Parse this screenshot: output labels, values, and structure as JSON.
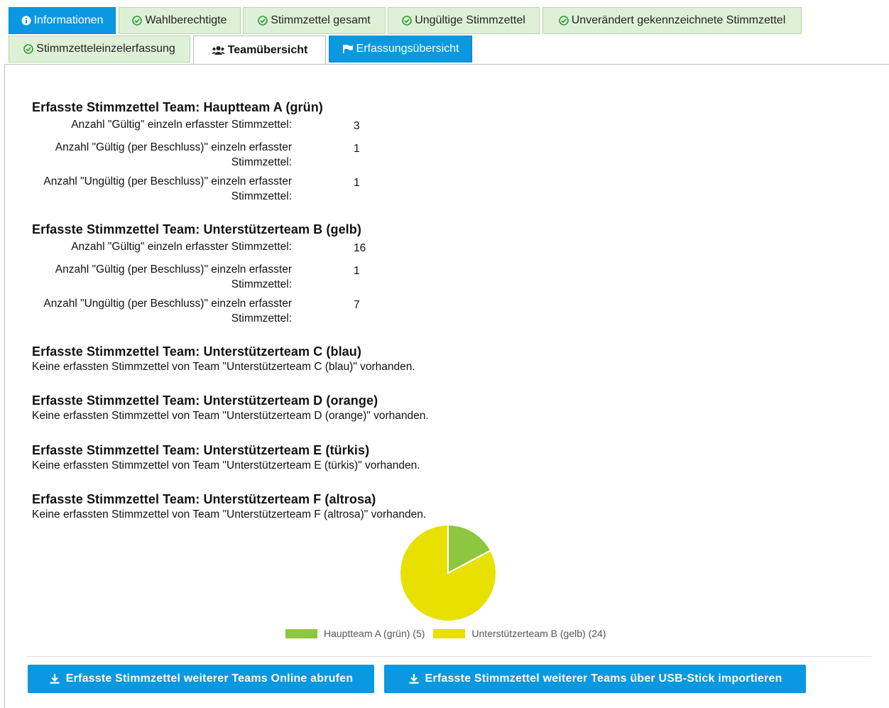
{
  "tabs": {
    "informationen": "Informationen",
    "wahlberechtigte": "Wahlberechtigte",
    "stimmzettel_gesamt": "Stimmzettel gesamt",
    "ungueltige": "Ungültige Stimmzettel",
    "unveraendert": "Unverändert gekennzeichnete Stimmzettel",
    "einzelerfassung": "Stimmzetteleinzelerfassung",
    "teamuebersicht": "Teamübersicht",
    "erfassungsuebersicht": "Erfassungsübersicht"
  },
  "teams": [
    {
      "title": "Erfasste Stimmzettel Team: Hauptteam A (grün)",
      "stats": [
        {
          "label": "Anzahl \"Gültig\" einzeln erfasster Stimmzettel:",
          "value": "3"
        },
        {
          "label": "Anzahl \"Gültig (per Beschluss)\" einzeln erfasster Stimmzettel:",
          "value": "1"
        },
        {
          "label": "Anzahl \"Ungültig (per Beschluss)\" einzeln erfasster Stimmzettel:",
          "value": "1"
        }
      ]
    },
    {
      "title": "Erfasste Stimmzettel Team: Unterstützerteam B (gelb)",
      "stats": [
        {
          "label": "Anzahl \"Gültig\" einzeln erfasster Stimmzettel:",
          "value": "16"
        },
        {
          "label": "Anzahl \"Gültig (per Beschluss)\" einzeln erfasster Stimmzettel:",
          "value": "1"
        },
        {
          "label": "Anzahl \"Ungültig (per Beschluss)\" einzeln erfasster Stimmzettel:",
          "value": "7"
        }
      ]
    },
    {
      "title": "Erfasste Stimmzettel Team: Unterstützerteam C (blau)",
      "empty": "Keine erfassten Stimmzettel von Team \"Unterstützerteam C (blau)\" vorhanden."
    },
    {
      "title": "Erfasste Stimmzettel Team: Unterstützerteam D (orange)",
      "empty": "Keine erfassten Stimmzettel von Team \"Unterstützerteam D (orange)\" vorhanden."
    },
    {
      "title": "Erfasste Stimmzettel Team: Unterstützerteam E (türkis)",
      "empty": "Keine erfassten Stimmzettel von Team \"Unterstützerteam E (türkis)\" vorhanden."
    },
    {
      "title": "Erfasste Stimmzettel Team: Unterstützerteam F (altrosa)",
      "empty": "Keine erfassten Stimmzettel von Team \"Unterstützerteam F (altrosa)\" vorhanden."
    }
  ],
  "chart_data": {
    "type": "pie",
    "slices": [
      {
        "label": "Hauptteam A (grün) (5)",
        "value": 5,
        "color": "#8dc63f"
      },
      {
        "label": "Unterstützerteam B (gelb) (24)",
        "value": 24,
        "color": "#e8e000"
      }
    ],
    "legend_position": "bottom"
  },
  "buttons": {
    "online": "Erfasste Stimmzettel weiterer Teams Online abrufen",
    "usb": "Erfasste Stimmzettel weiterer Teams über USB-Stick importieren"
  },
  "colors": {
    "accent_blue": "#0a98e0",
    "tab_green_bg": "#dff0d8",
    "check_green": "#2e9e2e"
  },
  "icons": {
    "tab_info": "info-circle-icon",
    "tab_check": "check-circle-icon",
    "tab_team": "users-icon",
    "tab_flag": "flag-icon",
    "button": "download-icon"
  }
}
